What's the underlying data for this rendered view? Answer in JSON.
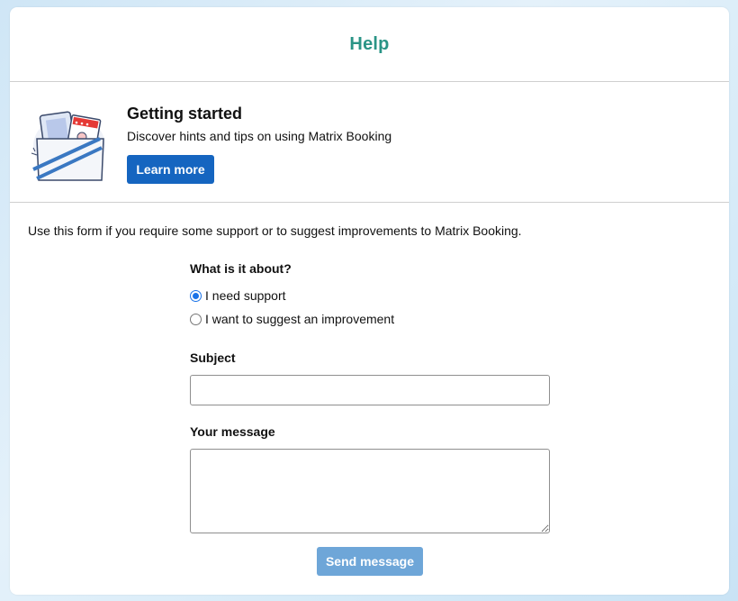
{
  "header": {
    "title": "Help"
  },
  "getting_started": {
    "title": "Getting started",
    "subtitle": "Discover hints and tips on using Matrix Booking",
    "button_label": "Learn more"
  },
  "form": {
    "intro": "Use this form if you require some support or to suggest improvements to Matrix Booking.",
    "question": "What is it about?",
    "options": [
      {
        "label": "I need support",
        "selected": true
      },
      {
        "label": "I want to suggest an improvement",
        "selected": false
      }
    ],
    "subject_label": "Subject",
    "subject_value": "",
    "message_label": "Your message",
    "message_value": "",
    "send_label": "Send message"
  },
  "colors": {
    "title": "#2a9486",
    "primary_button": "#1565c0",
    "send_button_disabled": "#6ea6d8",
    "radio_selected": "#1a73e8"
  }
}
